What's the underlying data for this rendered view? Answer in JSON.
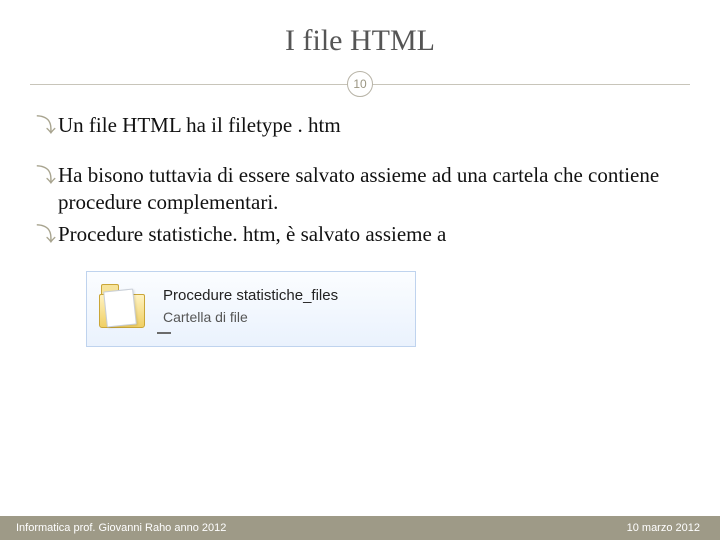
{
  "title": "I file HTML",
  "page_number": "10",
  "bullets": {
    "b1": "Un file HTML ha il filetype  . htm",
    "b2": "Ha bisono tuttavia di essere salvato assieme ad una cartela che contiene procedure complementari.",
    "b3": "Procedure statistiche. htm, è  salvato assieme a"
  },
  "folder": {
    "name": "Procedure statistiche_files",
    "type": "Cartella di file"
  },
  "footer": {
    "left": "Informatica prof. Giovanni Raho anno 2012",
    "right": "10 marzo 2012"
  }
}
